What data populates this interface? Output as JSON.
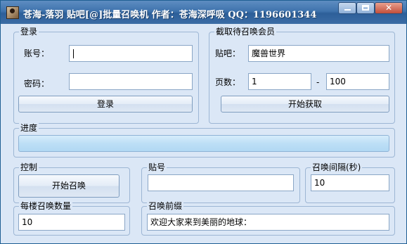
{
  "title": "苍海-落羽   贴吧[@]批量召唤机  作者：苍海深呼吸 QQ：1196601344",
  "window_controls": {
    "close_symbol": "✕"
  },
  "login": {
    "legend": "登录",
    "account_label": "账号：",
    "account_value": "",
    "password_label": "密码：",
    "password_value": "",
    "login_button": "登录"
  },
  "fetch": {
    "legend": "截取待召唤会员",
    "forum_label": "贴吧：",
    "forum_value": "魔兽世界",
    "pages_label": "页数：",
    "page_from": "1",
    "page_separator": "-",
    "page_to": "100",
    "start_button": "开始获取"
  },
  "progress": {
    "legend": "进度",
    "value": 0
  },
  "control": {
    "legend": "控制",
    "start_button": "开始召唤"
  },
  "post_id": {
    "legend": "贴号",
    "value": ""
  },
  "interval": {
    "legend": "召唤间隔(秒)",
    "value": "10"
  },
  "per_floor": {
    "legend": "每楼召唤数量",
    "value": "10"
  },
  "prefix": {
    "legend": "召唤前缀",
    "value": "欢迎大家来到美丽的地球："
  },
  "colors": {
    "window_bg": "#dbe7f6",
    "titlebar": "#3f73ad",
    "group_border": "#9db6d4",
    "progress_fill": "#bddff6"
  }
}
